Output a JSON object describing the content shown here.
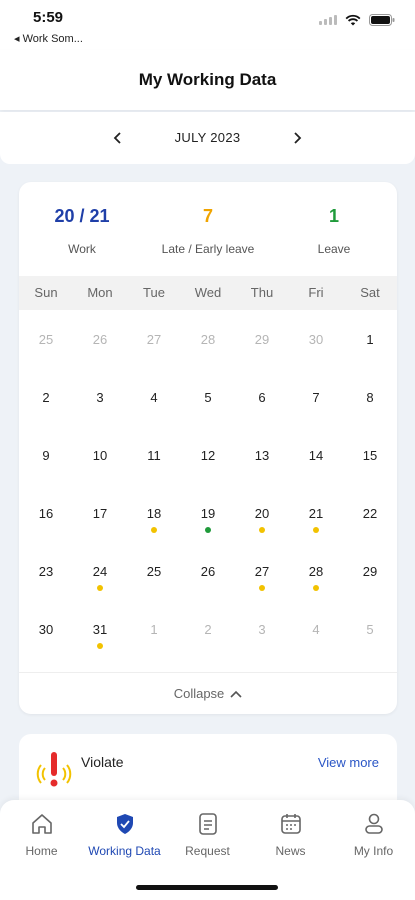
{
  "status_bar": {
    "time": "5:59",
    "back_label": "◂ Work Som..."
  },
  "header": {
    "title": "My Working Data"
  },
  "month_selector": {
    "label": "JULY 2023",
    "prev_icon": "chevron-left-icon",
    "next_icon": "chevron-right-icon"
  },
  "summary": {
    "work": {
      "value": "20 / 21",
      "label": "Work",
      "color": "#1f3fa8"
    },
    "late": {
      "value": "7",
      "label": "Late / Early leave",
      "color": "#f0a400"
    },
    "leave": {
      "value": "1",
      "label": "Leave",
      "color": "#1f9a3a"
    }
  },
  "calendar": {
    "weekdays": [
      "Sun",
      "Mon",
      "Tue",
      "Wed",
      "Thu",
      "Fri",
      "Sat"
    ],
    "weeks": [
      [
        {
          "d": "25",
          "muted": true
        },
        {
          "d": "26",
          "muted": true
        },
        {
          "d": "27",
          "muted": true
        },
        {
          "d": "28",
          "muted": true
        },
        {
          "d": "29",
          "muted": true
        },
        {
          "d": "30",
          "muted": true
        },
        {
          "d": "1"
        }
      ],
      [
        {
          "d": "2"
        },
        {
          "d": "3"
        },
        {
          "d": "4"
        },
        {
          "d": "5"
        },
        {
          "d": "6"
        },
        {
          "d": "7"
        },
        {
          "d": "8"
        }
      ],
      [
        {
          "d": "9"
        },
        {
          "d": "10"
        },
        {
          "d": "11"
        },
        {
          "d": "12"
        },
        {
          "d": "13"
        },
        {
          "d": "14"
        },
        {
          "d": "15"
        }
      ],
      [
        {
          "d": "16"
        },
        {
          "d": "17"
        },
        {
          "d": "18",
          "dot": "late"
        },
        {
          "d": "19",
          "dot": "leave"
        },
        {
          "d": "20",
          "dot": "late"
        },
        {
          "d": "21",
          "dot": "late"
        },
        {
          "d": "22"
        }
      ],
      [
        {
          "d": "23"
        },
        {
          "d": "24",
          "dot": "late"
        },
        {
          "d": "25"
        },
        {
          "d": "26"
        },
        {
          "d": "27",
          "dot": "late"
        },
        {
          "d": "28",
          "dot": "late"
        },
        {
          "d": "29"
        }
      ],
      [
        {
          "d": "30"
        },
        {
          "d": "31",
          "dot": "late"
        },
        {
          "d": "1",
          "muted": true
        },
        {
          "d": "2",
          "muted": true
        },
        {
          "d": "3",
          "muted": true
        },
        {
          "d": "4",
          "muted": true
        },
        {
          "d": "5",
          "muted": true
        }
      ]
    ],
    "collapse_label": "Collapse"
  },
  "violate": {
    "title": "Violate",
    "view_more": "View more",
    "icon": "alarm-exclamation-icon"
  },
  "tabbar": {
    "tabs": [
      {
        "label": "Home",
        "icon": "home-icon",
        "active": false
      },
      {
        "label": "Working Data",
        "icon": "shield-check-icon",
        "active": true
      },
      {
        "label": "Request",
        "icon": "document-icon",
        "active": false
      },
      {
        "label": "News",
        "icon": "calendar-icon",
        "active": false
      },
      {
        "label": "My Info",
        "icon": "person-icon",
        "active": false
      }
    ]
  }
}
